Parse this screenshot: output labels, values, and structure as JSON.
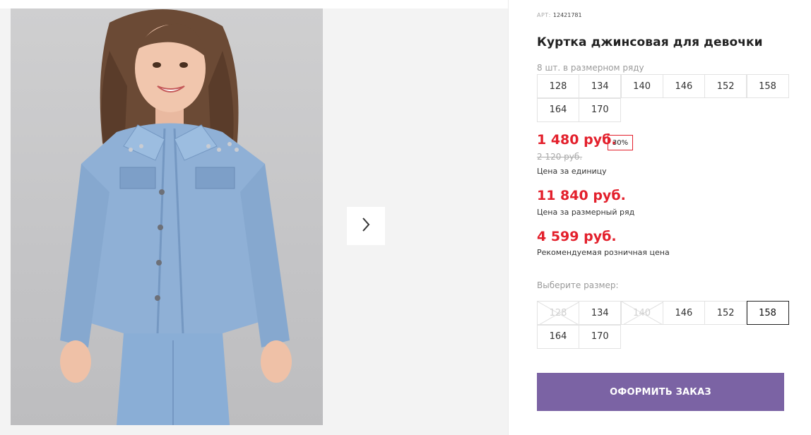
{
  "gallery": {
    "photo_alt": "Куртка джинсовая для девочки",
    "next_icon": "chevron-right-icon"
  },
  "product": {
    "article_label": "АРТ:",
    "article_value": "12421781",
    "title": "Куртка джинсовая для девочки",
    "size_row_note": "8 шт. в размерном ряду",
    "size_row": [
      "128",
      "134",
      "140",
      "146",
      "152",
      "158",
      "164",
      "170"
    ]
  },
  "pricing": {
    "unit_price": "1 480 руб.",
    "discount": "30%",
    "old_price": "2 120 руб.",
    "unit_caption": "Цена за единицу",
    "row_price": "11 840 руб.",
    "row_caption": "Цена за размерный ряд",
    "retail_price": "4 599 руб.",
    "retail_caption": "Рекомендуемая розничная цена"
  },
  "size_picker": {
    "label": "Выберите размер:",
    "sizes": [
      {
        "label": "128",
        "available": false,
        "selected": false
      },
      {
        "label": "134",
        "available": true,
        "selected": false
      },
      {
        "label": "140",
        "available": false,
        "selected": false
      },
      {
        "label": "146",
        "available": true,
        "selected": false
      },
      {
        "label": "152",
        "available": true,
        "selected": false
      },
      {
        "label": "158",
        "available": true,
        "selected": true
      },
      {
        "label": "164",
        "available": true,
        "selected": false
      },
      {
        "label": "170",
        "available": true,
        "selected": false
      }
    ]
  },
  "order_button": {
    "label": "ОФОРМИТЬ ЗАКАЗ"
  },
  "colors": {
    "price_red": "#e3202c",
    "button_purple": "#7b63a4",
    "gallery_bg": "#f3f3f3"
  }
}
